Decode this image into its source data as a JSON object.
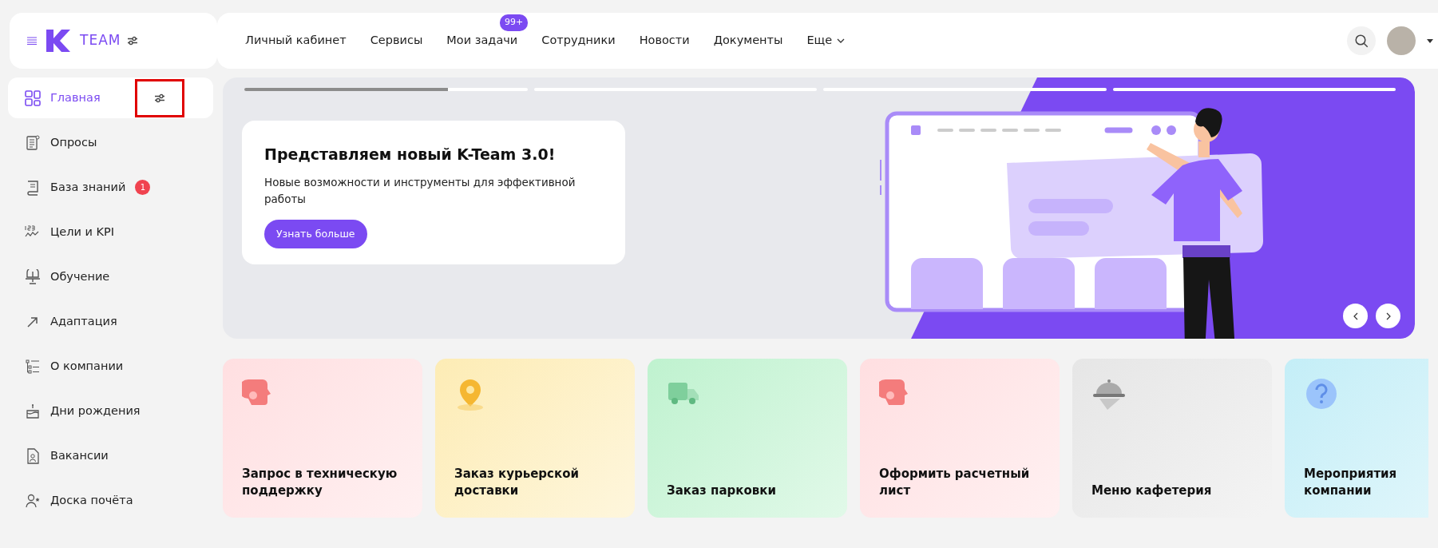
{
  "header": {
    "logo_text": "TEAM",
    "nav": [
      {
        "label": "Личный кабинет"
      },
      {
        "label": "Сервисы"
      },
      {
        "label": "Мои задачи",
        "badge": "99+"
      },
      {
        "label": "Сотрудники"
      },
      {
        "label": "Новости"
      },
      {
        "label": "Документы"
      },
      {
        "label": "Еще",
        "dropdown": true
      }
    ]
  },
  "sidebar": {
    "settings_highlighted": true,
    "items": [
      {
        "label": "Главная",
        "selected": true
      },
      {
        "label": "Опросы",
        "selected": false
      },
      {
        "label": "База знаний",
        "selected": false,
        "badge": "1"
      },
      {
        "label": "Цели и KPI",
        "selected": false
      },
      {
        "label": "Обучение",
        "selected": false
      },
      {
        "label": "Адаптация",
        "selected": false
      },
      {
        "label": "О компании",
        "selected": false
      },
      {
        "label": "Дни рождения",
        "selected": false
      },
      {
        "label": "Вакансии",
        "selected": false
      },
      {
        "label": "Доска почёта",
        "selected": false
      }
    ]
  },
  "banner": {
    "slides": [
      {
        "level": 0.72
      },
      {
        "level": 0
      },
      {
        "level": 0
      },
      {
        "level": 0
      }
    ],
    "title": "Представляем новый K-Team 3.0!",
    "text": "Новые возможности и инструменты для эффективной работы",
    "button": "Узнать больше"
  },
  "services": [
    {
      "title": "Запрос в техническую поддержку",
      "color": "#ffdfe1"
    },
    {
      "title": "Заказ курьерской доставки",
      "color": "#fdecb5"
    },
    {
      "title": "Заказ парковки",
      "color": "#bff2cf"
    },
    {
      "title": "Оформить расчетный лист",
      "color": "#ffdfe1"
    },
    {
      "title": "Меню кафетерия",
      "color": "#e6e6e6"
    },
    {
      "title": "Мероприятия компании",
      "color": "#c4eef7"
    }
  ]
}
